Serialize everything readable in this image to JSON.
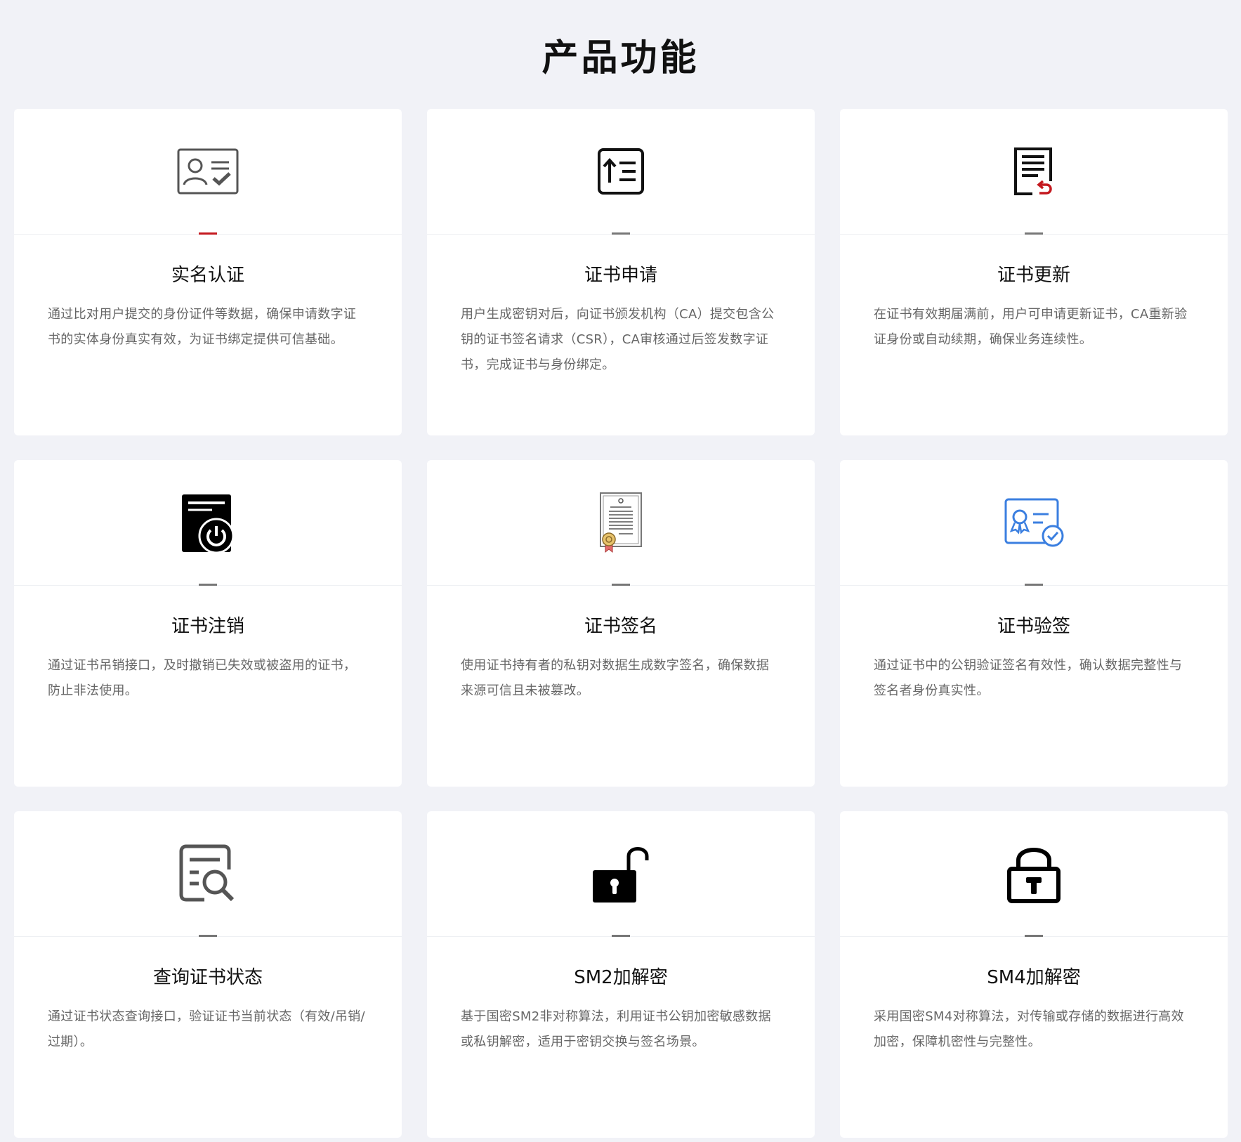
{
  "page": {
    "title": "产品功能"
  },
  "accent_color": "#c4191f",
  "cards": [
    {
      "icon": "id-card-check-icon",
      "title": "实名认证",
      "desc": "通过比对用户提交的身份证件等数据，确保申请数字证书的实体身份真实有效，为证书绑定提供可信基础。"
    },
    {
      "icon": "upload-list-icon",
      "title": "证书申请",
      "desc": "用户生成密钥对后，向证书颁发机构（CA）提交包含公钥的证书签名请求（CSR），CA审核通过后签发数字证书，完成证书与身份绑定。"
    },
    {
      "icon": "document-renew-icon",
      "title": "证书更新",
      "desc": "在证书有效期届满前，用户可申请更新证书，CA重新验证身份或自动续期，确保业务连续性。"
    },
    {
      "icon": "certificate-power-icon",
      "title": "证书注销",
      "desc": "通过证书吊销接口，及时撤销已失效或被盗用的证书，防止非法使用。"
    },
    {
      "icon": "certificate-seal-icon",
      "title": "证书签名",
      "desc": "使用证书持有者的私钥对数据生成数字签名，确保数据来源可信且未被篡改。"
    },
    {
      "icon": "certificate-verify-icon",
      "title": "证书验签",
      "desc": "通过证书中的公钥验证签名有效性，确认数据完整性与签名者身份真实性。"
    },
    {
      "icon": "document-search-icon",
      "title": "查询证书状态",
      "desc": "通过证书状态查询接口，验证证书当前状态（有效/吊销/过期）。"
    },
    {
      "icon": "unlock-icon",
      "title": "SM2加解密",
      "desc": "基于国密SM2非对称算法，利用证书公钥加密敏感数据或私钥解密，适用于密钥交换与签名场景。"
    },
    {
      "icon": "lock-icon",
      "title": "SM4加解密",
      "desc": "采用国密SM4对称算法，对传输或存储的数据进行高效加密，保障机密性与完整性。"
    }
  ]
}
